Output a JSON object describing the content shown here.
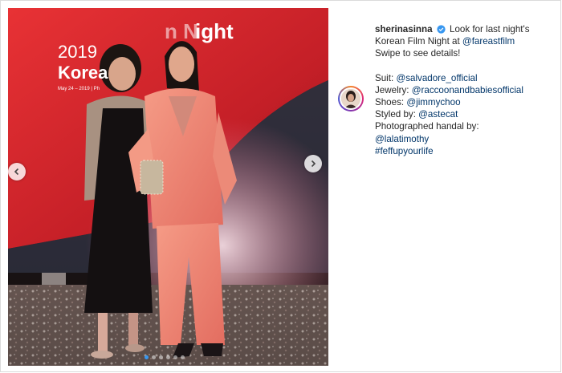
{
  "post": {
    "username": "sherinasinna",
    "caption_line1": "Look for last night's Korean Film Night at",
    "caption_link1": "@fareastfilm",
    "caption_line2": "Swipe to see details!"
  },
  "credits": [
    {
      "label": "Suit:",
      "value": "@salvadore_official"
    },
    {
      "label": "Jewelry:",
      "value": "@raccoonandbabiesofficial"
    },
    {
      "label": "Shoes:",
      "value": "@jimmychoo"
    },
    {
      "label": "Styled by:",
      "value": "@astecat"
    },
    {
      "label": "Photographed handal by:",
      "value": ""
    },
    {
      "label": "",
      "value": "@lalatimothy"
    },
    {
      "label": "",
      "value": "#feffupyourlife"
    }
  ],
  "poster": {
    "year": "2019",
    "title_left": "Korea",
    "title_right": "ight",
    "title_fragment": "n N",
    "subtitle": "May 24 – 2019 | Ph"
  },
  "carousel": {
    "dot_count": 6,
    "active_index": 0
  },
  "icons": {
    "prev": "chevron-left-icon",
    "next": "chevron-right-icon",
    "verified": "verified-badge-icon"
  },
  "colors": {
    "link": "#003569",
    "verified": "#3897f0",
    "poster_red": "#d6282c"
  }
}
